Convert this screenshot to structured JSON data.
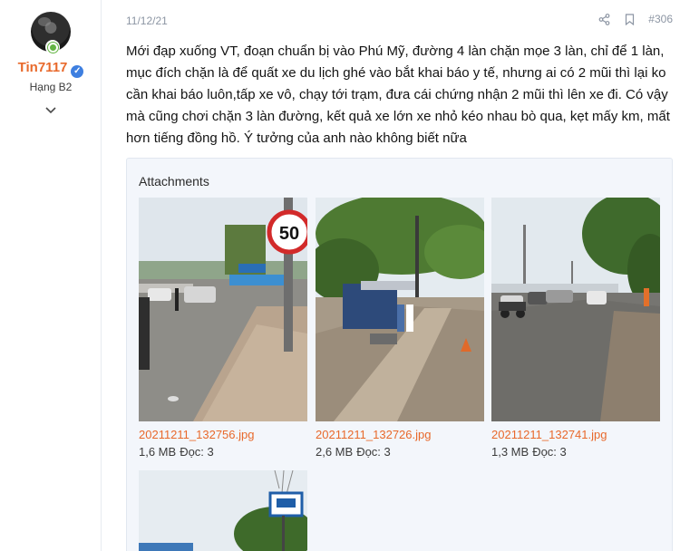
{
  "user": {
    "name": "Tin7117",
    "rank": "Hạng B2"
  },
  "post": {
    "date": "11/12/21",
    "number": "#306",
    "body": "Mới đạp xuống VT, đoạn chuẩn bị vào Phú Mỹ, đường 4 làn chặn mọe 3 làn, chỉ để 1 làn, mục đích chặn là để quất xe du lịch ghé vào bắt khai báo y tế, nhưng ai có 2 mũi thì lại ko cần khai báo luôn,tấp xe vô, chạy tới trạm, đưa cái chứng nhận 2 mũi thì lên xe đi. Có vậy mà cũng chơi chặn 3 làn đường, kết quả xe lớn xe nhỏ kéo nhau bò qua, kẹt mấy km, mất hơn tiếng đồng hồ. Ý tưởng của anh nào không biết nữa"
  },
  "attachments": {
    "title": "Attachments",
    "items": [
      {
        "filename": "20211211_132756.jpg",
        "size": "1,6 MB",
        "views": "Đọc: 3",
        "sign": "50"
      },
      {
        "filename": "20211211_132726.jpg",
        "size": "2,6 MB",
        "views": "Đọc: 3"
      },
      {
        "filename": "20211211_132741.jpg",
        "size": "1,3 MB",
        "views": "Đọc: 3"
      }
    ]
  }
}
